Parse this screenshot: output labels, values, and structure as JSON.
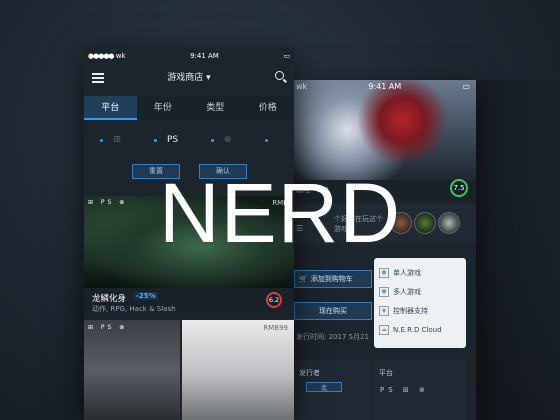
{
  "overlay": {
    "brand": "NERD"
  },
  "front_phone": {
    "status": {
      "carrier": "wk",
      "time": "9:41 AM"
    },
    "nav": {
      "title": "游戏商店 ▾"
    },
    "tabs": [
      {
        "label": "平台",
        "active": true
      },
      {
        "label": "年份",
        "active": false
      },
      {
        "label": "类型",
        "active": false
      },
      {
        "label": "价格",
        "active": false
      }
    ],
    "platforms": [
      {
        "name": "windows-icon",
        "glyph": "⊞",
        "selected": false
      },
      {
        "name": "playstation-icon",
        "glyph": "PS",
        "selected": true
      },
      {
        "name": "xbox-icon",
        "glyph": "⊗",
        "selected": false
      },
      {
        "name": "apple-icon",
        "glyph": "",
        "selected": false
      }
    ],
    "filter_buttons": {
      "reset": "重置",
      "confirm": "确认"
    },
    "game1": {
      "icons": "⊞ PS ⊗",
      "price": "RMB",
      "name": "龙鳞化身",
      "discount": "-25%",
      "tags": "动作, RPG, Hack & Slash",
      "score": "6.2"
    },
    "game2": {
      "icons": "⊞ PS ⊗",
      "price": "RMB99"
    }
  },
  "back_phone": {
    "status": {
      "carrier": "wk",
      "time": "9:41 AM"
    },
    "subtitle": "冒险 · 3 D",
    "score": "7.5",
    "friends_text": "个好友在玩这个游戏",
    "add_to_cart": "添加到购物车",
    "buy_now": "现在购买",
    "release": "发行时间: 2017 5月21",
    "features": [
      {
        "icon": "person-icon",
        "label": "单人游戏"
      },
      {
        "icon": "people-icon",
        "label": "多人游戏"
      },
      {
        "icon": "gamepad-icon",
        "label": "控制器支持"
      },
      {
        "icon": "cloud-icon",
        "label": "N.E.R.D Cloud"
      }
    ],
    "publisher_label": "发行者",
    "platform_label": "平台",
    "platform_icons": "PS ⊞ ⊗"
  },
  "colors": {
    "accent": "#2f9bff",
    "bg": "#1c242c",
    "score_red": "#e13a3a",
    "score_green": "#2ccf5a"
  }
}
